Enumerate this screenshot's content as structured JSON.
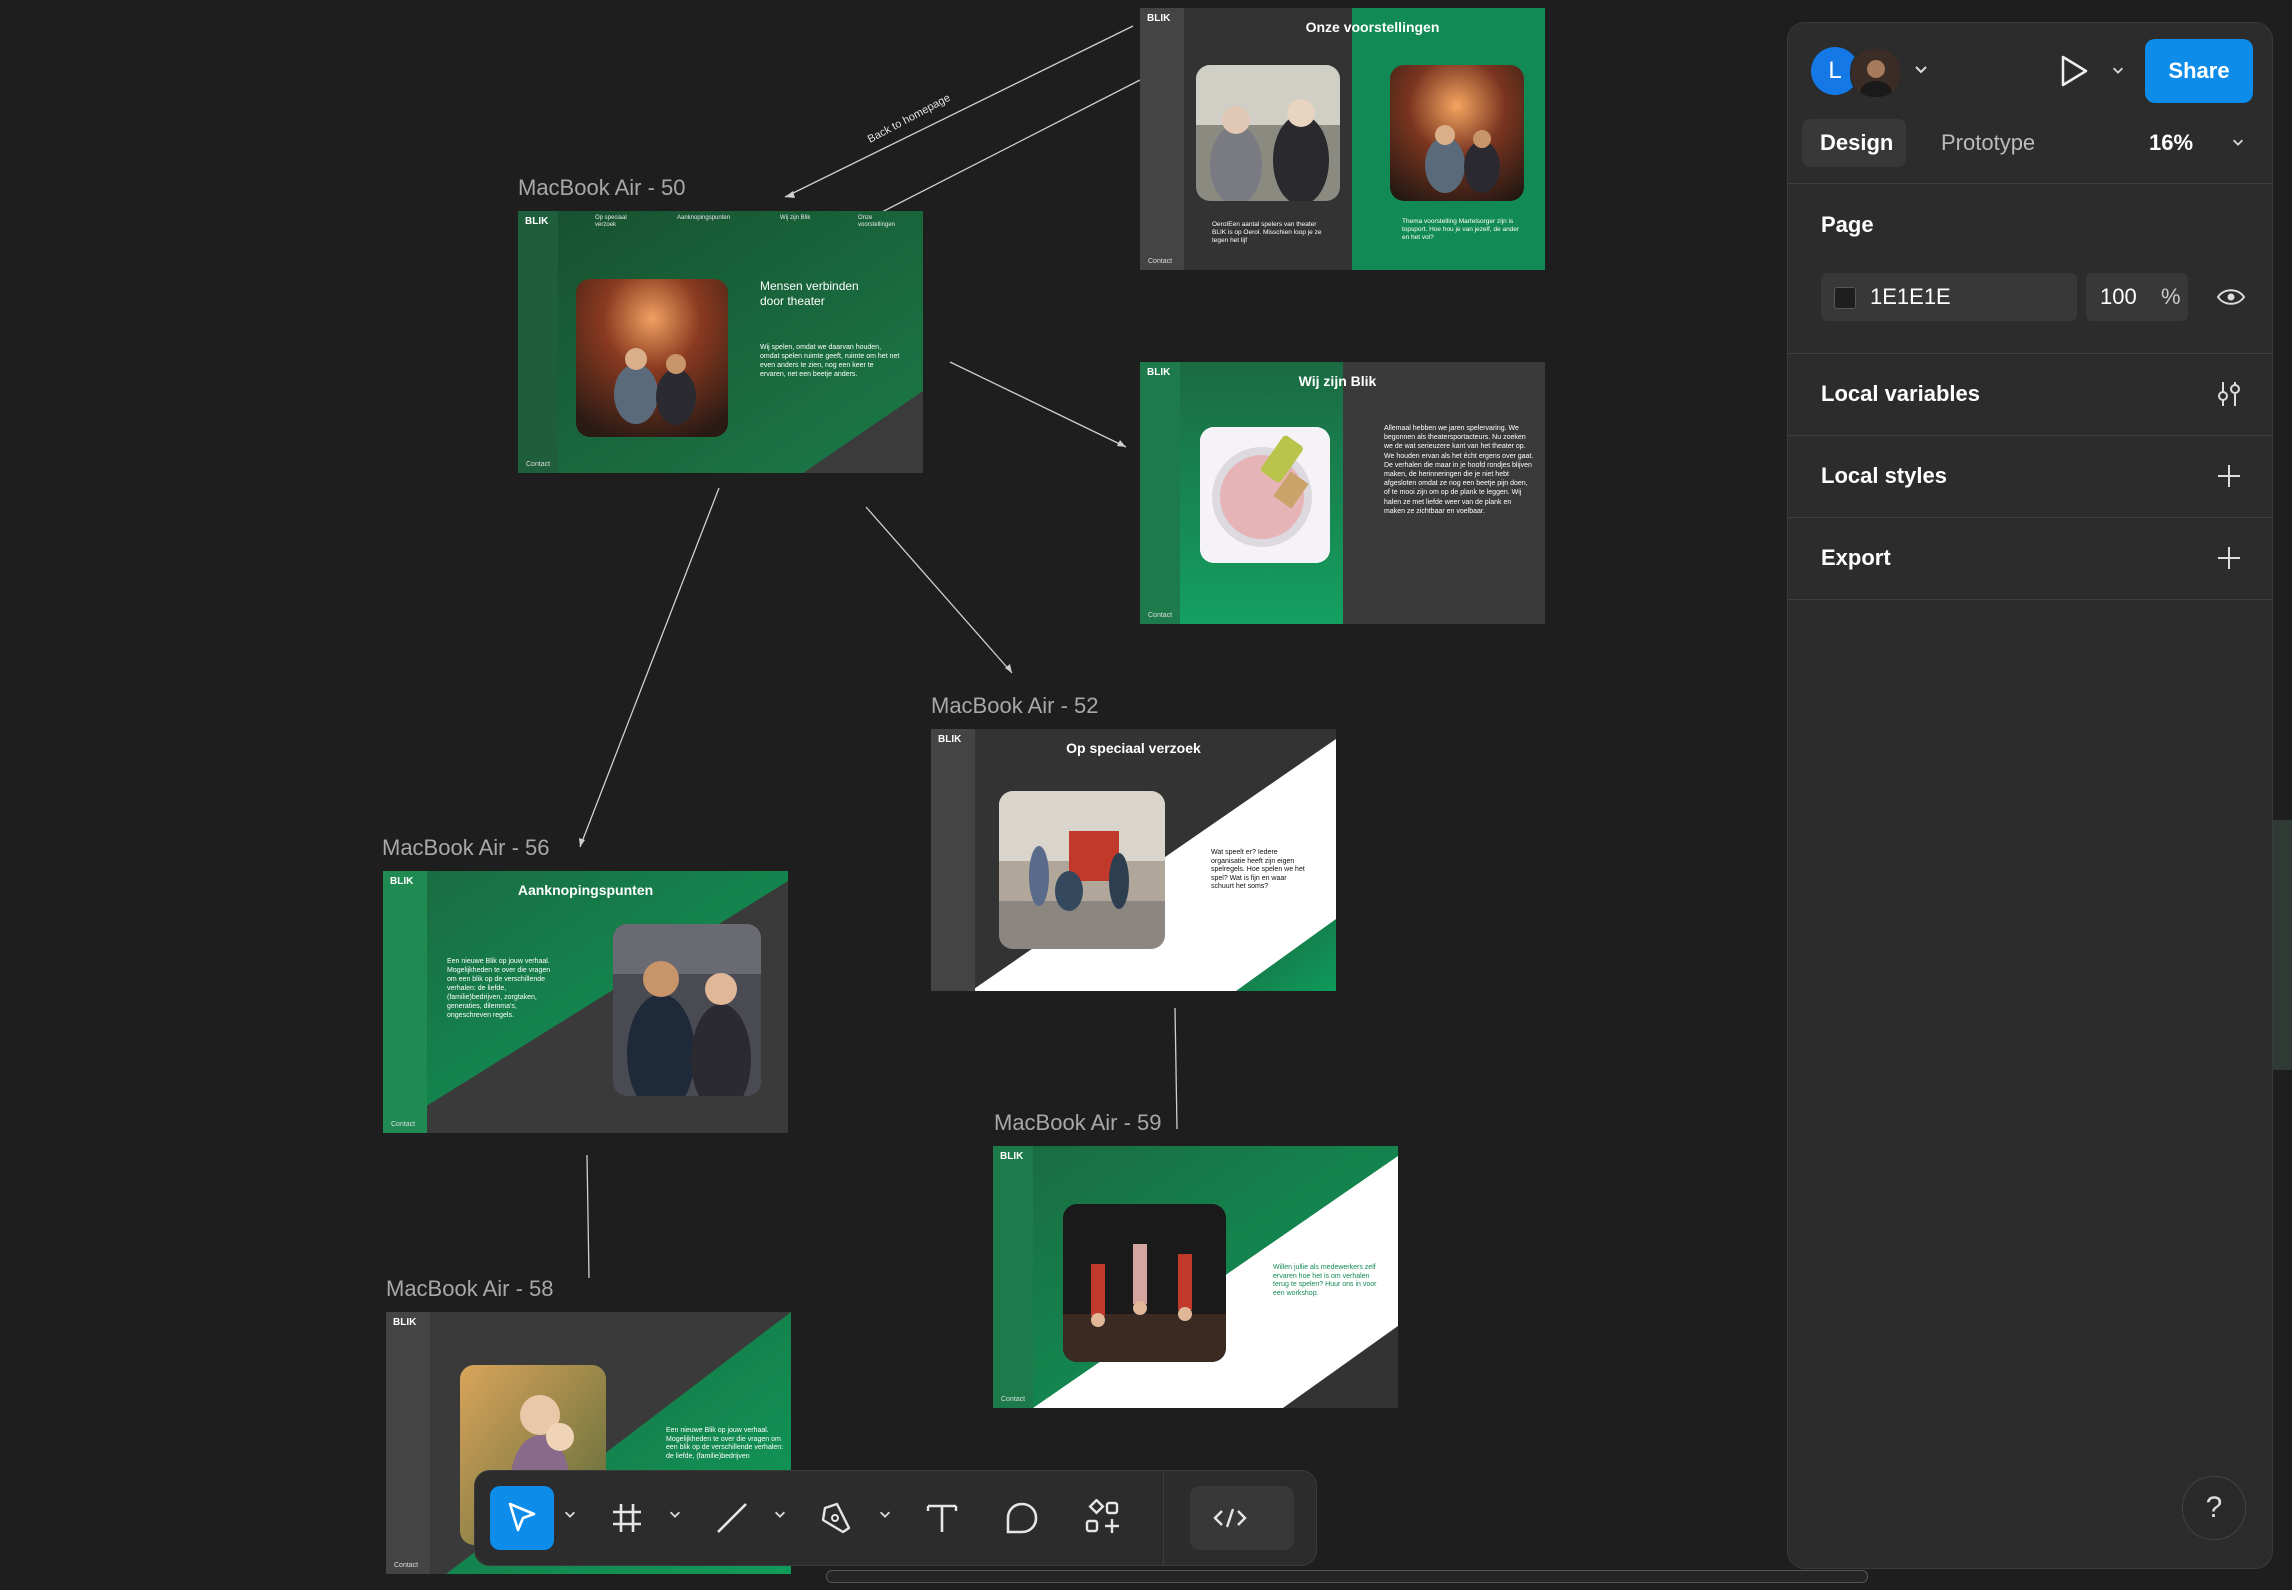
{
  "canvas": {
    "background": "#1e1e1e"
  },
  "frames": [
    {
      "id": "f50",
      "label": "MacBook Air - 50",
      "logo": "BLIK",
      "contact": "Contact",
      "nav": [
        "Op speciaal verzoek",
        "Aanknopingspunten",
        "Wij zijn Blik",
        "Onze voorstellingen"
      ],
      "heading": "Mensen verbinden door theater",
      "body": "Wij spelen, omdat we daarvan houden, omdat spelen ruimte geeft, ruimte om het net even anders te zien, nog een keer te ervaren, net een beetje anders."
    },
    {
      "id": "fvoor",
      "logo": "BLIK",
      "contact": "Contact",
      "title": "Onze voorstellingen",
      "text_left": "OeroIEen aantal spelers van theater BLIK is op Oerol. Misschien loop je ze tegen het lijf",
      "text_right": "Thema voorstelling Martelsorger zijn is topsport. Hoe hou je van jezelf, de ander en het vol?"
    },
    {
      "id": "fwij",
      "logo": "BLIK",
      "contact": "Contact",
      "title": "Wij zijn Blik",
      "body": "Allemaal hebben we jaren spelervaring. We begonnen als theatersportacteurs. Nu zoeken we de wat serieuzere kant van het theater op. We houden ervan als het écht ergens over gaat. De verhalen die maar in je hoofd rondjes blijven maken, de herinneringen die je niet hebt afgesloten omdat ze nog een beetje pijn doen, of te mooi zijn om op de plank te leggen. Wij halen ze met liefde weer van de plank en maken ze zichtbaar en voelbaar."
    },
    {
      "id": "f52",
      "label": "MacBook Air - 52",
      "logo": "BLIK",
      "title": "Op speciaal verzoek",
      "body": "Wat speelt er? Iedere organisatie heeft zijn eigen spelregels. Hoe spelen we het spel? Wat is fijn en waar schuurt het soms?"
    },
    {
      "id": "f56",
      "label": "MacBook Air - 56",
      "logo": "BLIK",
      "contact": "Contact",
      "title": "Aanknopingspunten",
      "body": "Een nieuwe Blik op jouw verhaal. Mogelijkheden te over die vragen om een blik op de verschillende verhalen: de liefde, (familie)bedrijven, zorgtaken, generaties, dilemma's, ongeschreven regels."
    },
    {
      "id": "f59",
      "label": "MacBook Air - 59",
      "logo": "BLIK",
      "contact": "Contact",
      "body": "Willen jullie als medewerkers zelf ervaren hoe het is om verhalen terug te spelen? Huur ons in voor een workshop."
    },
    {
      "id": "f58",
      "label": "MacBook Air - 58",
      "logo": "BLIK",
      "contact": "Contact",
      "body": "Een nieuwe Blik op jouw verhaal. Mogelijkheden te over die vragen om een blik op de verschillende verhalen: de liefde, (familie)bedrijven"
    }
  ],
  "connector_label": "Back to homepage",
  "panel": {
    "avatar_initial": "L",
    "share_label": "Share",
    "tabs": [
      "Design",
      "Prototype"
    ],
    "zoom": "16%",
    "page_heading": "Page",
    "page_color": "1E1E1E",
    "page_opacity": "100",
    "percent": "%",
    "sections": [
      "Local variables",
      "Local styles",
      "Export"
    ]
  },
  "help_label": "?",
  "icons": [
    "chevron-down-icon",
    "play-icon",
    "eye-icon",
    "variables-icon",
    "plus-icon",
    "move-tool-icon",
    "frame-tool-icon",
    "line-tool-icon",
    "pen-tool-icon",
    "text-tool-icon",
    "comment-tool-icon",
    "assets-icon",
    "dev-mode-icon"
  ]
}
